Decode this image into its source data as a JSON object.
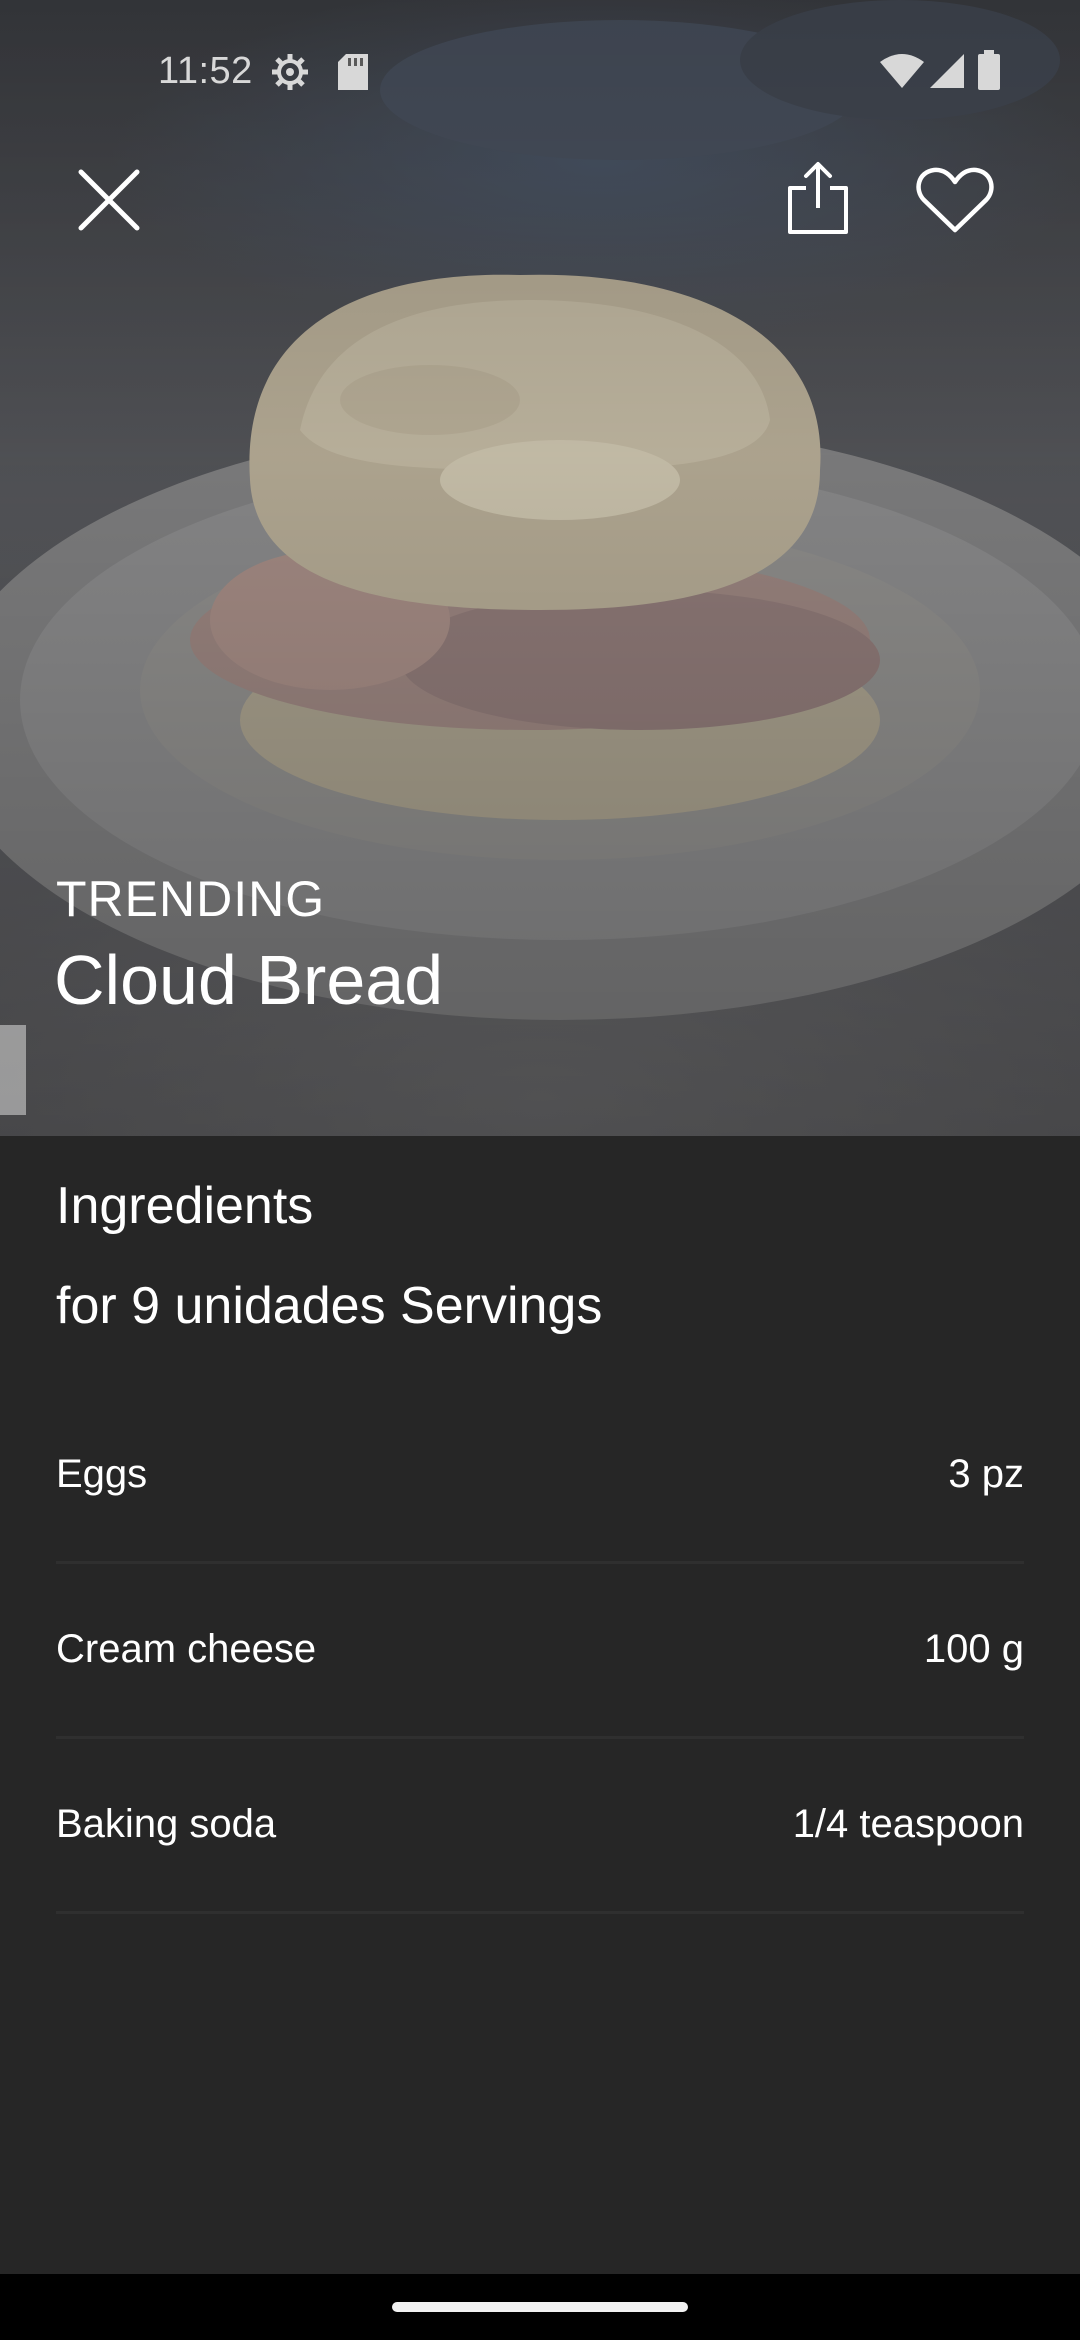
{
  "status_bar": {
    "time": "11:52",
    "icons": [
      "settings-gear-icon",
      "sd-card-icon",
      "wifi-icon",
      "cell-signal-icon",
      "battery-icon"
    ]
  },
  "top_actions": {
    "close_icon": "close-icon",
    "share_icon": "share-icon",
    "favorite_icon": "heart-icon"
  },
  "hero": {
    "label": "TRENDING",
    "title": "Cloud Bread"
  },
  "ingredients": {
    "title": "Ingredients",
    "servings": "for 9 unidades Servings",
    "items": [
      {
        "name": "Eggs",
        "qty": "3 pz"
      },
      {
        "name": "Cream cheese",
        "qty": "100 g"
      },
      {
        "name": "Baking soda",
        "qty": "1/4 teaspoon"
      }
    ]
  },
  "colors": {
    "background": "#262626",
    "divider": "#2f2f2f",
    "text": "#ffffff"
  }
}
